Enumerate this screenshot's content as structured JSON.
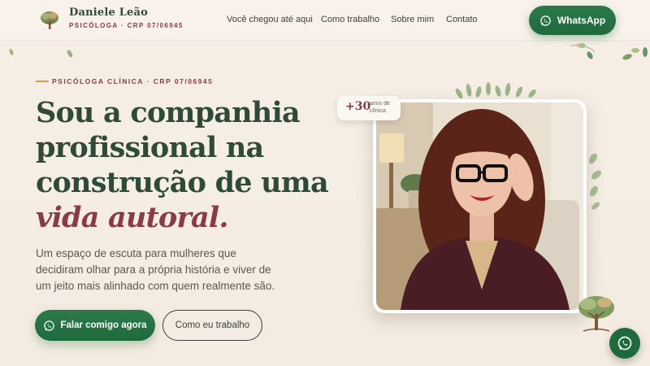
{
  "brand": {
    "name": "Daniele Leão",
    "subtitle": "PSICÓLOGA · CRP 07/06945"
  },
  "nav": {
    "items": [
      "Você chegou até aqui",
      "Como trabalho",
      "Sobre mim",
      "Contato"
    ]
  },
  "header": {
    "whatsapp_label": "WhatsApp"
  },
  "hero": {
    "eyebrow": "PSICÓLOGA CLÍNICA · CRP 07/06945",
    "headline_lines": [
      "Sou a companhia",
      "profissional na",
      "construção de uma"
    ],
    "headline_accent": "vida autoral.",
    "lede": "Um espaço de escuta para mulheres que decidiram olhar para a própria história e viver de um jeito mais alinhado com quem realmente são.",
    "cta_primary": "Falar comigo agora",
    "cta_secondary": "Como eu trabalho"
  },
  "badge": {
    "number": "+30",
    "text": "anos de clínica"
  },
  "colors": {
    "primary_green": "#1f6a3d",
    "heading_green": "#2f4a36",
    "accent_wine": "#8b3a47",
    "gold": "#c9a15a",
    "background": "#f6efe6"
  },
  "icons": {
    "logo": "tree-icon",
    "whatsapp": "whatsapp-icon"
  }
}
